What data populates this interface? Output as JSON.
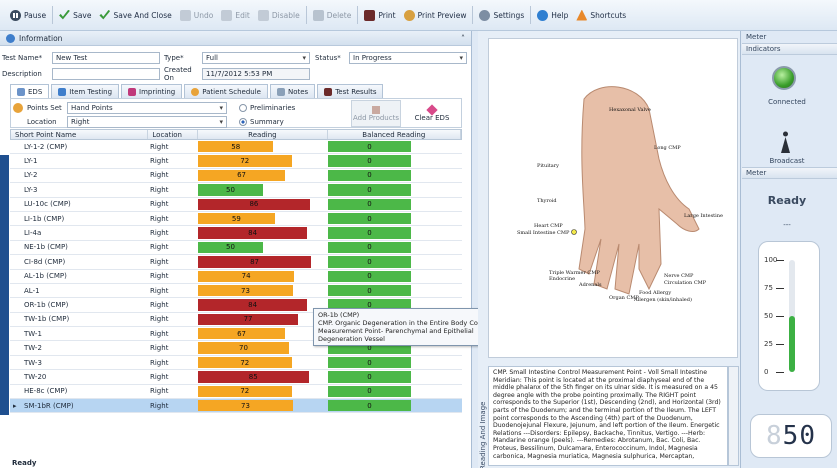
{
  "toolbar": {
    "pause": "Pause",
    "save": "Save",
    "save_close": "Save And Close",
    "undo": "Undo",
    "edit": "Edit",
    "disable": "Disable",
    "delete": "Delete",
    "print": "Print",
    "print_preview": "Print Preview",
    "settings": "Settings",
    "help": "Help",
    "shortcuts": "Shortcuts"
  },
  "information": {
    "title": "Information",
    "test_name_label": "Test Name*",
    "test_name": "New Test",
    "type_label": "Type*",
    "type": "Full",
    "status_label": "Status*",
    "status": "In Progress",
    "description_label": "Description",
    "description": "",
    "created_on_label": "Created On",
    "created_on": "11/7/2012 5:53 PM"
  },
  "tabs": [
    "EDS",
    "Item Testing",
    "Imprinting",
    "Patient Schedule",
    "Notes",
    "Test Results"
  ],
  "eds": {
    "points_set_label": "Points Set",
    "points_set": "Hand Points",
    "location_label": "Location",
    "location": "Right",
    "preliminaries": "Preliminaries",
    "summary": "Summary",
    "add_products": "Add Products",
    "clear_eds": "Clear EDS"
  },
  "grid": {
    "headers": [
      "Short Point Name",
      "Location",
      "Reading",
      "Balanced Reading"
    ],
    "rows": [
      {
        "name": "LY-1-2 (CMP)",
        "location": "Right",
        "reading": 58,
        "balanced": 0,
        "color": "#f5a623"
      },
      {
        "name": "LY-1",
        "location": "Right",
        "reading": 72,
        "balanced": 0,
        "color": "#f5a623"
      },
      {
        "name": "LY-2",
        "location": "Right",
        "reading": 67,
        "balanced": 0,
        "color": "#f5a623"
      },
      {
        "name": "LY-3",
        "location": "Right",
        "reading": 50,
        "balanced": 0,
        "color": "#4cb848"
      },
      {
        "name": "LU-10c (CMP)",
        "location": "Right",
        "reading": 86,
        "balanced": 0,
        "color": "#b3262a"
      },
      {
        "name": "LI-1b (CMP)",
        "location": "Right",
        "reading": 59,
        "balanced": 0,
        "color": "#f5a623"
      },
      {
        "name": "LI-4a",
        "location": "Right",
        "reading": 84,
        "balanced": 0,
        "color": "#b3262a"
      },
      {
        "name": "NE-1b (CMP)",
        "location": "Right",
        "reading": 50,
        "balanced": 0,
        "color": "#4cb848"
      },
      {
        "name": "CI-8d (CMP)",
        "location": "Right",
        "reading": 87,
        "balanced": 0,
        "color": "#b3262a"
      },
      {
        "name": "AL-1b (CMP)",
        "location": "Right",
        "reading": 74,
        "balanced": 0,
        "color": "#f5a623"
      },
      {
        "name": "AL-1",
        "location": "Right",
        "reading": 73,
        "balanced": 0,
        "color": "#f5a623"
      },
      {
        "name": "OR-1b (CMP)",
        "location": "Right",
        "reading": 84,
        "balanced": 0,
        "color": "#b3262a"
      },
      {
        "name": "TW-1b (CMP)",
        "location": "Right",
        "reading": 77,
        "balanced": 0,
        "color": "#b3262a"
      },
      {
        "name": "TW-1",
        "location": "Right",
        "reading": 67,
        "balanced": 0,
        "color": "#f5a623"
      },
      {
        "name": "TW-2",
        "location": "Right",
        "reading": 70,
        "balanced": 0,
        "color": "#f5a623"
      },
      {
        "name": "TW-3",
        "location": "Right",
        "reading": 72,
        "balanced": 0,
        "color": "#f5a623"
      },
      {
        "name": "TW-20",
        "location": "Right",
        "reading": 85,
        "balanced": 0,
        "color": "#b3262a"
      },
      {
        "name": "HE-8c (CMP)",
        "location": "Right",
        "reading": 72,
        "balanced": 0,
        "color": "#f5a623"
      },
      {
        "name": "SM-1bR (CMP)",
        "location": "Right",
        "reading": 73,
        "balanced": 0,
        "color": "#f5a623"
      }
    ],
    "selected_index": 18,
    "balanced_color": "#4cb848"
  },
  "tooltip": {
    "line1": "OR-1b (CMP)",
    "line2": "CMP. Organic Degeneration in the Entire Body Control Measurement Point- Parenchymal and Epithelial Degeneration Vessel"
  },
  "status_bar": "Ready",
  "image_panel": {
    "side_label": "Reading And Image",
    "labels": [
      "Hexaxonal Valve",
      "Long CMP",
      "Pituitary",
      "Thyroid",
      "Large Intestine",
      "Heart CMP",
      "Small Intestine CMP",
      "Triple Warmer CMP",
      "Endocrine",
      "Adrenals",
      "Nerve CMP",
      "Circulation CMP",
      "Organ CMP",
      "Food Allergy",
      "Allergen (skin/inhaled)"
    ],
    "description": "CMP. Small Intestine Control Measurement Point - Voll Small Intestine Meridian: This point is located at the proximal diaphyseal end of the middle phalanx of the 5th finger on its ulnar side. It is measured on a 45 degree angle with the probe pointing proximally. The RIGHT point corresponds to the Superior (1st), Descending (2nd), and Horizontal (3rd) parts of the Duodenum; and the terminal portion of the Ileum. The LEFT point corresponds to the Ascending (4th) part of the Duodenum, Duodenojejunal Flexure, Jejunum, and left portion of the Ileum. Energetic Relations ---Disorders: Epilepsy, Backache, Tinnitus, Vertigo. ---Herb: Mandarine orange (peels). ---Remedies: Abrotanum, Bac. Coli, Bac. Proteus, Bessilinum, Dulcamara, Enterococcinum, Indol, Magnesia carbonica, Magnesia muriatica, Magnesia sulphurica, Mercaptan,"
  },
  "meter": {
    "title": "Meter",
    "indicators": "Indicators",
    "connected": "Connected",
    "broadcast": "Broadcast",
    "meter_label": "Meter",
    "ready": "Ready",
    "dashes": "---",
    "ticks": [
      "100",
      "75",
      "50",
      "25",
      "0"
    ],
    "gauge_value": 50,
    "display": "50",
    "led_color": "#3a9e2a"
  }
}
